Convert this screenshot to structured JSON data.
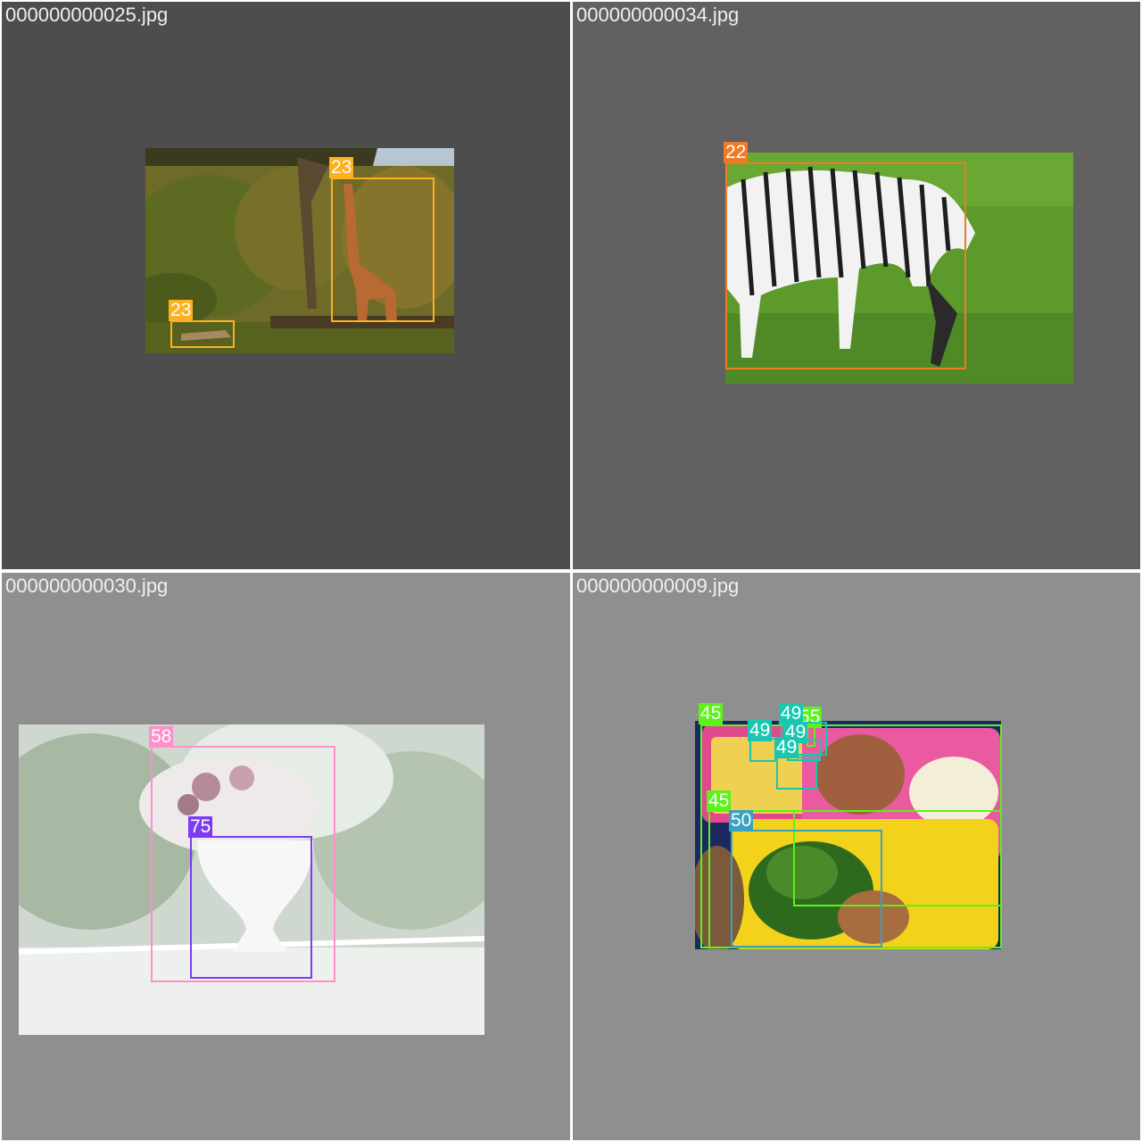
{
  "colors": {
    "tile_bg_dark": "#4d4d4d",
    "tile_bg_mid": "#616161",
    "tile_bg_light": "#8f8f8f",
    "divider": "#ffffff",
    "class_22": "#f07a26",
    "class_23": "#ffb01f",
    "class_45": "#5cf21a",
    "class_49": "#19c7b0",
    "class_50": "#3aa1c2",
    "class_58": "#ff8ec9",
    "class_75": "#7c3cf2"
  },
  "tiles": [
    {
      "filename": "000000000025.jpg",
      "detections": [
        {
          "label": "23",
          "color": "#ffb01f"
        },
        {
          "label": "23",
          "color": "#ffb01f"
        }
      ]
    },
    {
      "filename": "000000000034.jpg",
      "detections": [
        {
          "label": "22",
          "color": "#f07a26"
        }
      ]
    },
    {
      "filename": "000000000030.jpg",
      "detections": [
        {
          "label": "58",
          "color": "#ff8ec9"
        },
        {
          "label": "75",
          "color": "#7c3cf2"
        }
      ]
    },
    {
      "filename": "000000000009.jpg",
      "detections": [
        {
          "label": "45",
          "color": "#5cf21a"
        },
        {
          "label": "49",
          "color": "#19c7b0"
        },
        {
          "label": "55",
          "color": "#5cf21a"
        },
        {
          "label": "49",
          "color": "#19c7b0"
        },
        {
          "label": "49",
          "color": "#19c7b0"
        },
        {
          "label": "49",
          "color": "#19c7b0"
        },
        {
          "label": "45",
          "color": "#5cf21a"
        },
        {
          "label": "50",
          "color": "#3aa1c2"
        }
      ]
    }
  ]
}
